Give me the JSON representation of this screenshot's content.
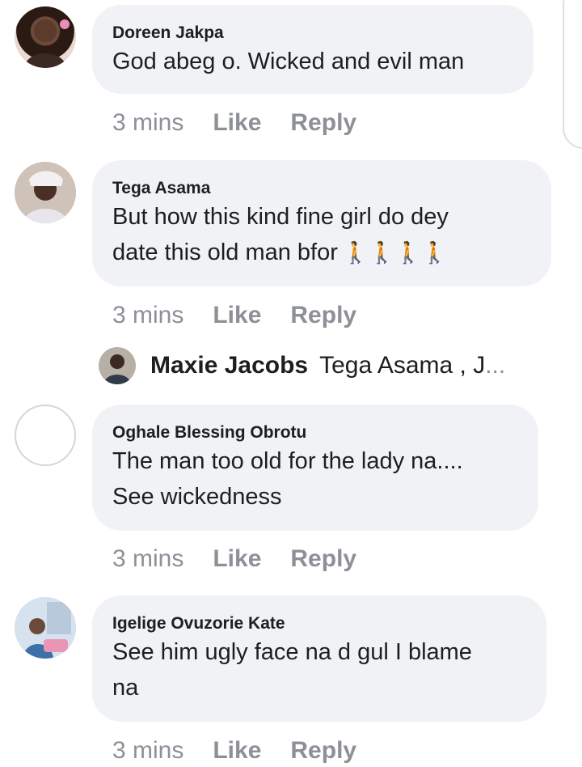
{
  "comments": [
    {
      "author": "Doreen Jakpa",
      "lines": [
        "God abeg o. Wicked and evil man"
      ],
      "time": "3 mins",
      "like": "Like",
      "reply": "Reply"
    },
    {
      "author": "Tega Asama",
      "lines": [
        "But how this kind fine girl do dey",
        "date this old man bfor"
      ],
      "emoji": "🚶🚶🚶🚶",
      "time": "3 mins",
      "like": "Like",
      "reply": "Reply"
    },
    {
      "author": "Oghale Blessing Obrotu",
      "lines": [
        "The man too old for the lady na....",
        "See wickedness"
      ],
      "time": "3 mins",
      "like": "Like",
      "reply": "Reply"
    },
    {
      "author": "Igelige Ovuzorie Kate",
      "lines": [
        "See him ugly face na d gul I blame",
        "na"
      ],
      "time": "3 mins",
      "like": "Like",
      "reply": "Reply"
    }
  ],
  "reply_preview": {
    "author": "Maxie Jacobs",
    "text": "Tega Asama , J",
    "ellipsis": "..."
  }
}
